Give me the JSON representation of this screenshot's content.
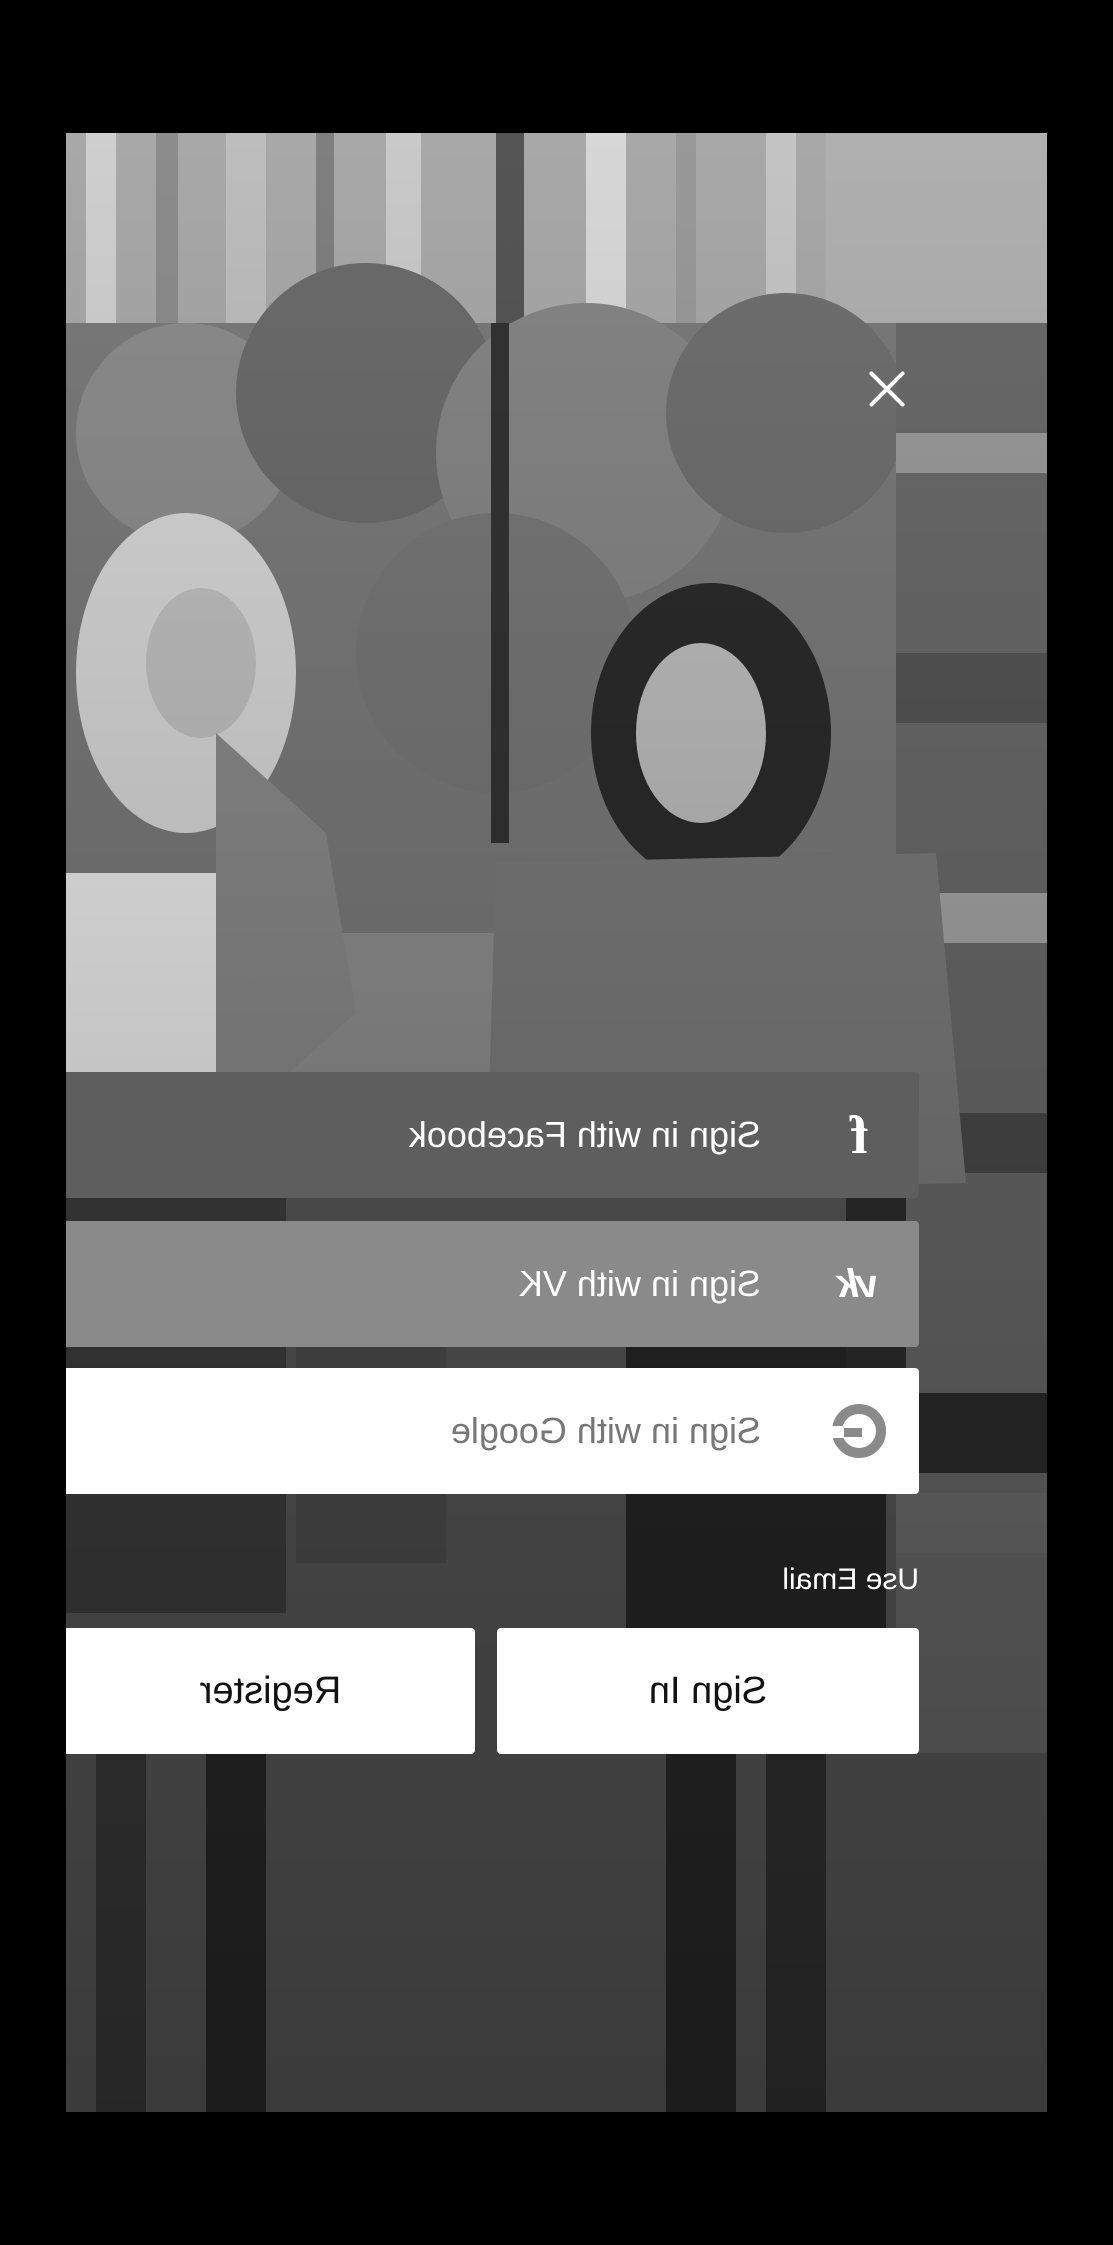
{
  "auth": {
    "facebook_label": "Sign in with Facebook",
    "vk_label": "Sign in with VK",
    "google_label": "Sign in with Google",
    "use_email_label": "Use Email",
    "sign_in_label": "Sign In",
    "register_label": "Register"
  },
  "icons": {
    "close": "close-icon",
    "facebook": "facebook-icon",
    "vk": "vk-icon",
    "google": "google-icon"
  },
  "colors": {
    "facebook_button": "#5e5e5e",
    "vk_button": "#8a8a8a",
    "google_button": "#ffffff",
    "action_button": "#ffffff"
  }
}
